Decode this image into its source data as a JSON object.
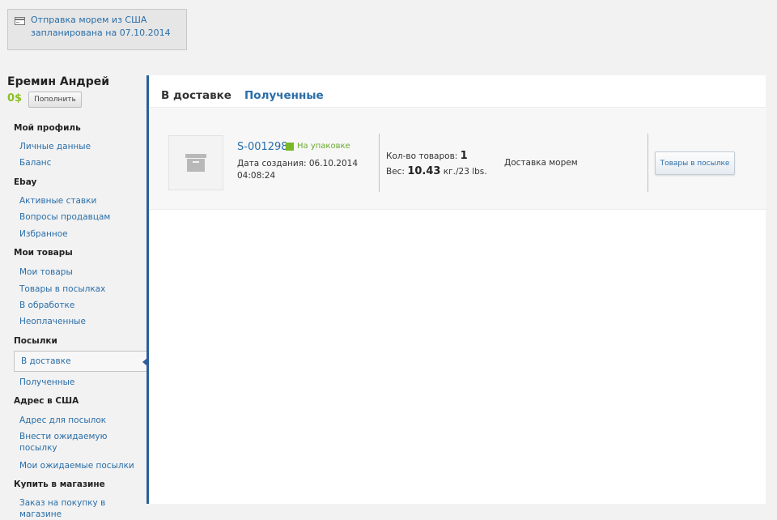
{
  "notice": {
    "line1": "Отправка морем из США",
    "line2": "запланирована на 07.10.2014",
    "icon": "card-icon"
  },
  "user": {
    "name": "Еремин Андрей",
    "balance": "0$",
    "topup_label": "Пополнить"
  },
  "menu": {
    "profile": {
      "title": "Мой профиль",
      "items": [
        "Личные данные",
        "Баланс"
      ]
    },
    "ebay": {
      "title": "Ebay",
      "items": [
        "Активные ставки",
        "Вопросы продавцам",
        "Избранное"
      ]
    },
    "goods": {
      "title": "Мои товары",
      "items": [
        "Мои товары",
        "Товары в посылках",
        "В обработке",
        "Неоплаченные"
      ]
    },
    "parcels": {
      "title": "Посылки",
      "items": [
        "В доставке",
        "Полученные"
      ]
    },
    "address": {
      "title": "Адрес в США",
      "items": [
        "Адрес для посылок",
        "Внести ожидаемую",
        "посылку",
        "Мои ожидаемые посылки"
      ]
    },
    "shop": {
      "title": "Купить в магазине",
      "items": [
        "Заказ на покупку в",
        "магазине"
      ]
    }
  },
  "tabs": {
    "current": "В доставке",
    "other": "Полученные"
  },
  "parcel": {
    "id": "S-001298",
    "status": "На упаковке",
    "status_color": "#7ab828",
    "created_line1": "Дата создания: 06.10.2014",
    "created_line2": "04:08:24",
    "count_label": "Кол-во товаров: ",
    "count_value": "1",
    "weight_label": "Вес: ",
    "weight_value": "10.43",
    "weight_unit": " кг./23 lbs.",
    "delivery": "Доставка морем",
    "items_button": "Товары в посылке",
    "thumb_icon": "box-icon"
  },
  "colors": {
    "accent": "#2c5f99",
    "link": "#2a6ea8",
    "balance": "#8cbf26"
  }
}
